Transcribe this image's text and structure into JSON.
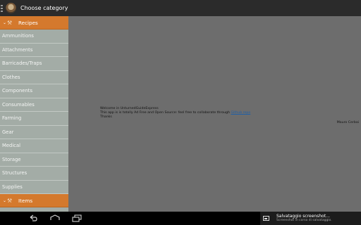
{
  "action_bar": {
    "title": "Choose category",
    "icon": "app-logo-icon"
  },
  "main": {
    "welcome_line": "Welcome in UnturnedGuideExpress",
    "line2_text": "This app is is totally Ad Free and Open Source: feel free to collaborate through ",
    "line2_link": "Github repo",
    "thanks": "Thanks",
    "author": "Mauro Cerbai"
  },
  "drawer": {
    "recipes_header": {
      "label": "Recipes",
      "icon": "hammer-icon"
    },
    "items_header": {
      "label": "Items",
      "icon": "tools-icon"
    },
    "categories": [
      "Ammunitions",
      "Attachments",
      "Barricades/Traps",
      "Clothes",
      "Components",
      "Consumables",
      "Farming",
      "Gear",
      "Medical",
      "Storage",
      "Structures",
      "Supplies"
    ]
  },
  "notification": {
    "title": "Salvataggio screenshot...",
    "subtitle": "Screenshot in corso di salvataggio."
  },
  "colors": {
    "accent": "#d4792d",
    "drawer_bg": "#a3aca6",
    "dim_content": "#6d6d6d",
    "action_bar": "#2b2b2b"
  }
}
